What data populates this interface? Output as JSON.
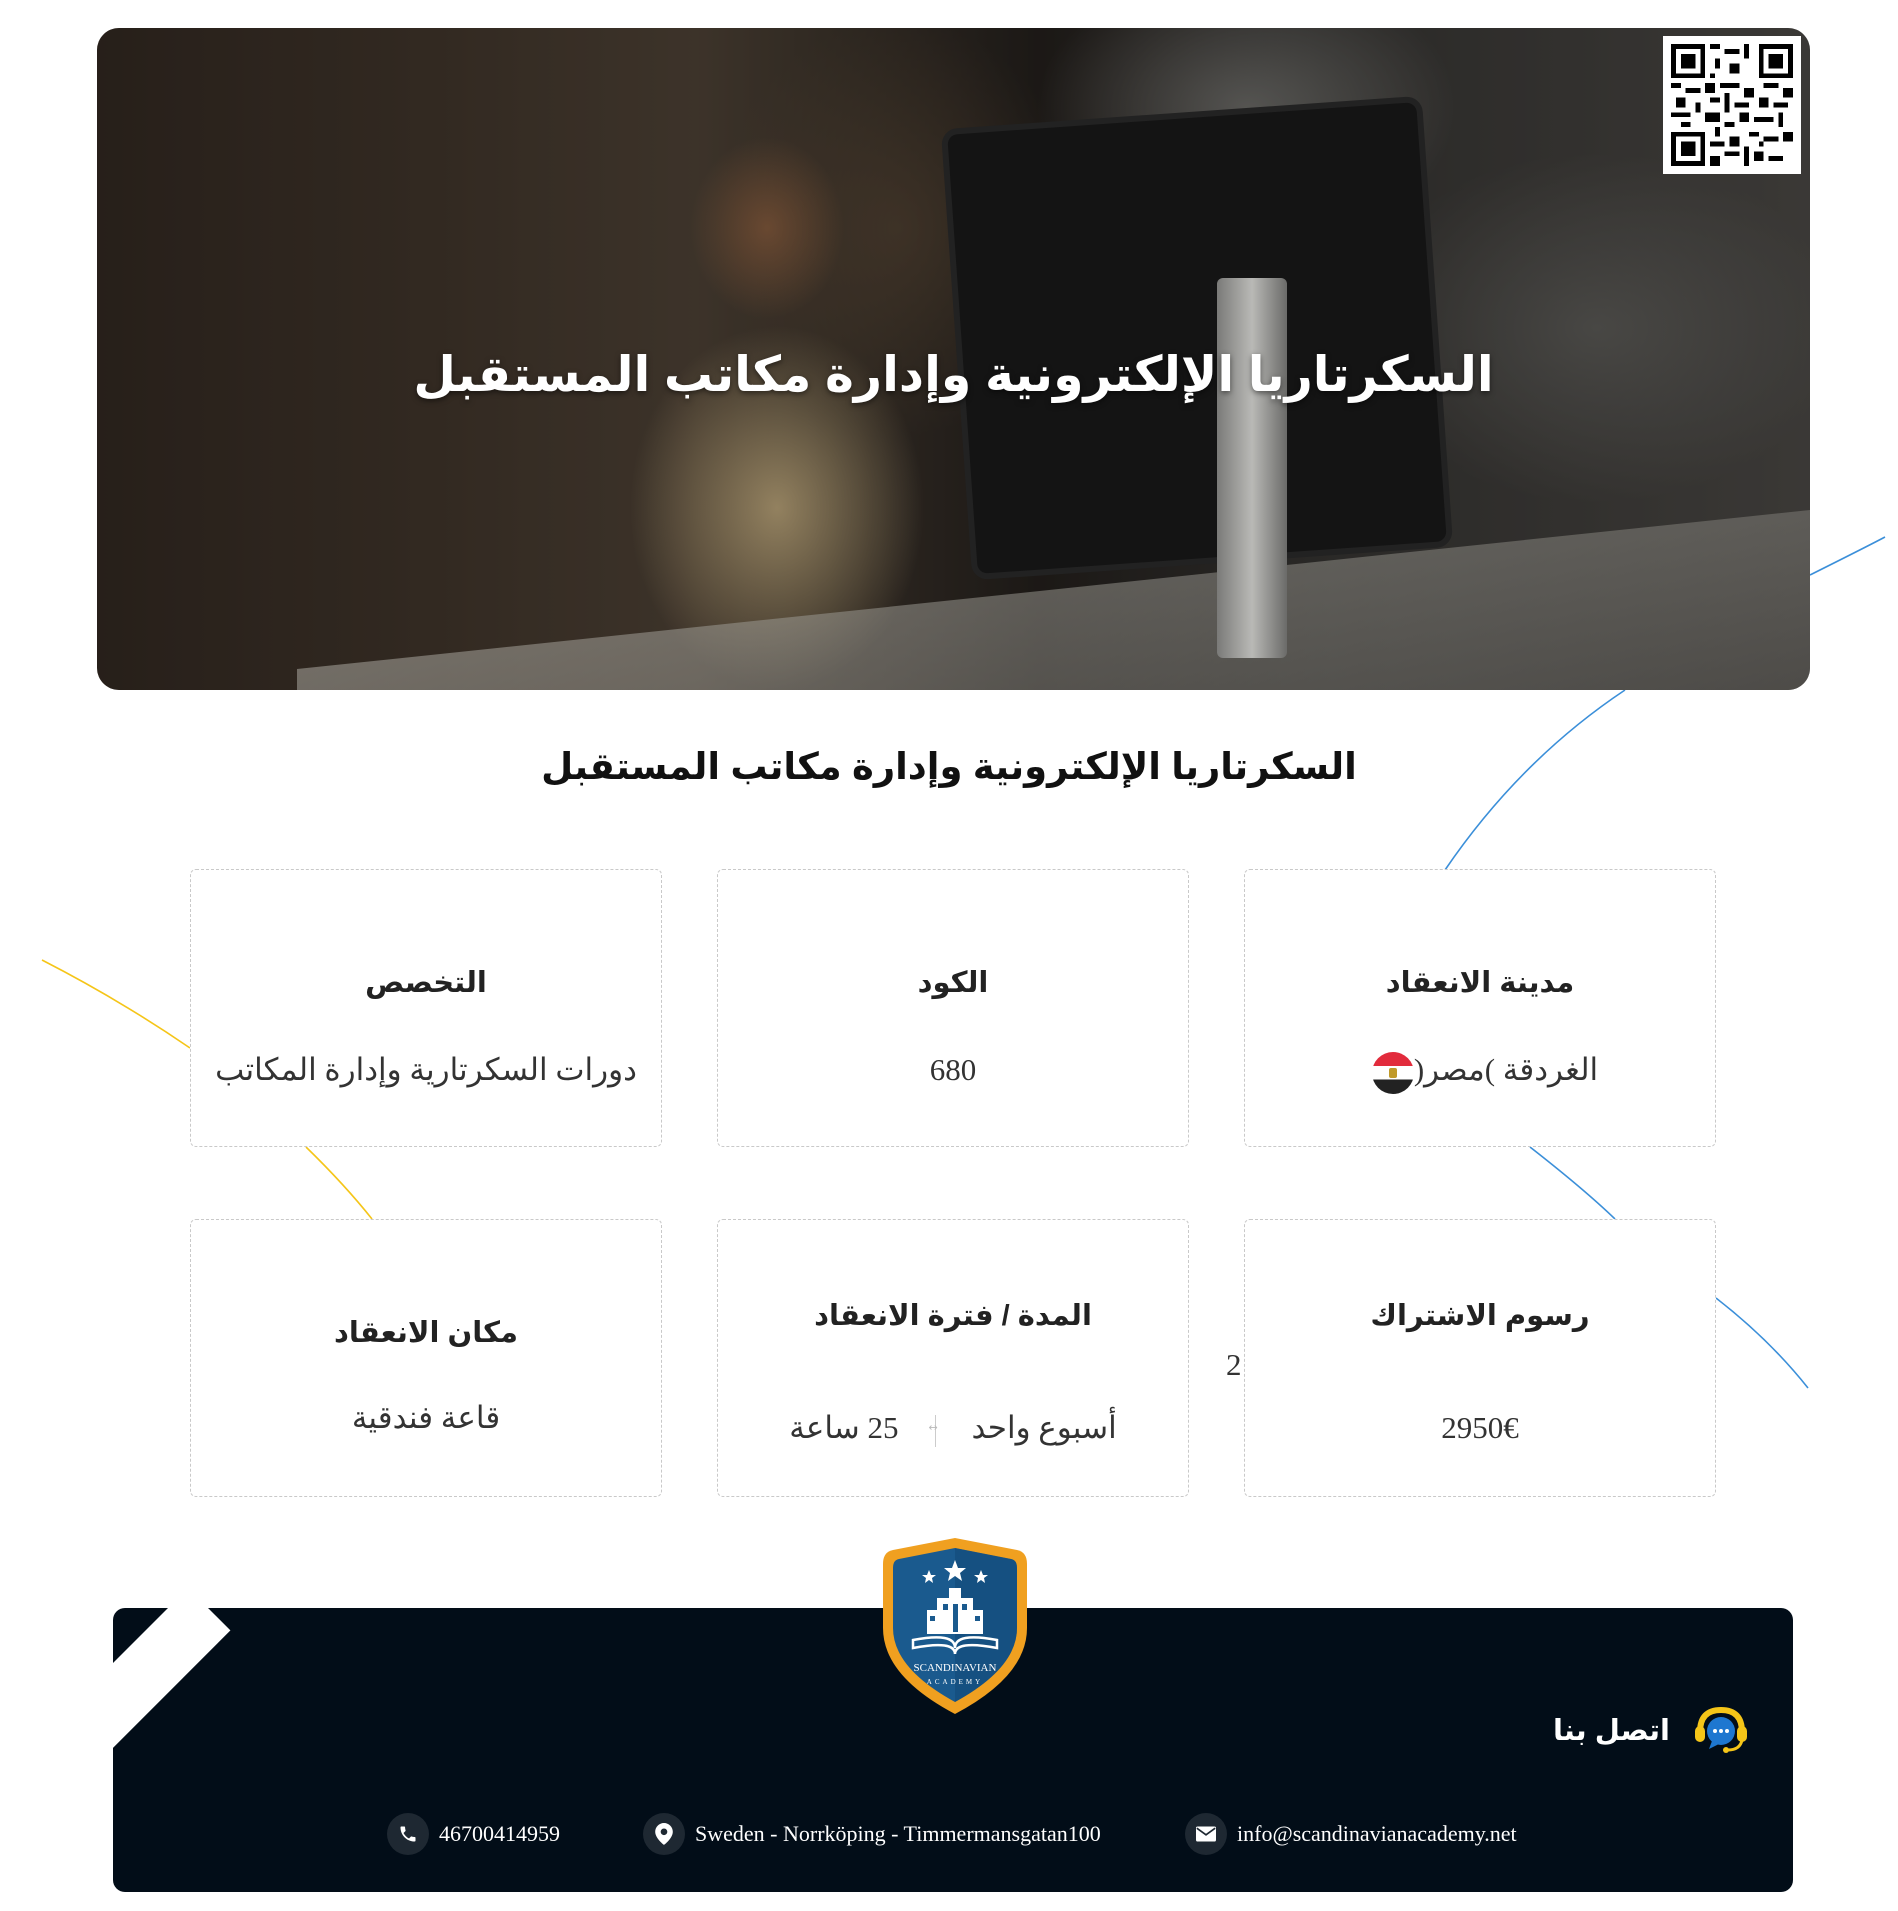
{
  "hero": {
    "title": "السكرتاريا الإلكترونية وإدارة مكاتب المستقبل",
    "qr_code_icon": "qr-code-icon"
  },
  "page_title": "السكرتاريا الإلكترونية وإدارة مكاتب المستقبل",
  "details": [
    {
      "label": "مدينة الانعقاد",
      "value": "الغردقة )مصر(",
      "icon": "egypt-flag-icon"
    },
    {
      "label": "الكود",
      "value": "680"
    },
    {
      "label": "التخصص",
      "value": "دورات السكرتارية وإدارة المكاتب"
    },
    {
      "label": "رسوم الاشتراك",
      "value": "2950€"
    },
    {
      "label": "المدة / فترة الانعقاد",
      "value_primary": "أسبوع واحد",
      "value_secondary": "25 ساعة"
    },
    {
      "label": "مكان الانعقاد",
      "value": "قاعة فندقية"
    }
  ],
  "stray_text": "2",
  "footer": {
    "logo_text_line1": "SCANDINAVIAN",
    "logo_text_line2": "ACADEMY",
    "contact_title": "اتصل بنا",
    "phone": "46700414959",
    "address": "Sweden - Norrköping - Timmermansgatan100",
    "email": "info@scandinavianacademy.net"
  },
  "colors": {
    "footer_bg": "#020d18",
    "accent_blue": "#3b8fd9",
    "accent_yellow": "#f5c518",
    "logo_blue": "#1a5a8e",
    "logo_gold": "#f0a020"
  }
}
